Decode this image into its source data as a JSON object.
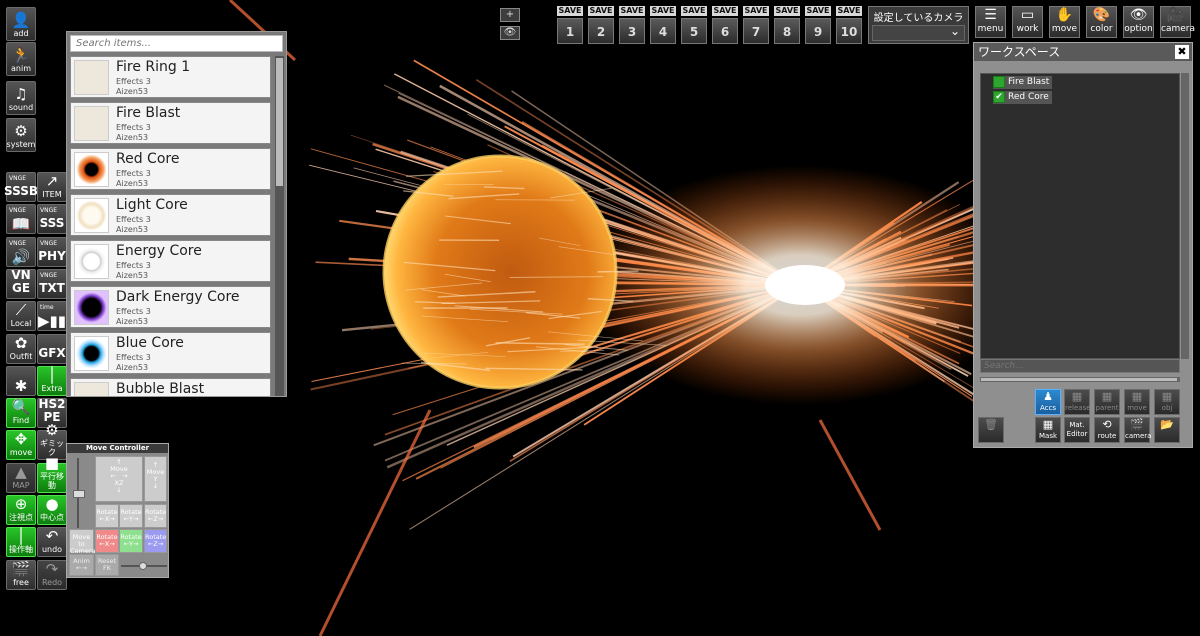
{
  "left_toolbar": [
    {
      "id": "add",
      "glyph": "👤",
      "label": "add",
      "style": "big"
    },
    {
      "id": "anim",
      "glyph": "🏃",
      "label": "anim",
      "style": "big"
    },
    {
      "id": "sound",
      "glyph": "♫",
      "label": "sound",
      "style": "big"
    },
    {
      "id": "system",
      "glyph": "⚙",
      "label": "system",
      "style": "big"
    },
    {
      "id": "vnge-ssb",
      "top": "VNGE",
      "text": "SSSB",
      "style": ""
    },
    {
      "id": "item",
      "glyph": "↗",
      "label": "ITEM",
      "style": ""
    },
    {
      "id": "vnge-book",
      "top": "VNGE",
      "glyph": "📖",
      "style": ""
    },
    {
      "id": "vnge-sss",
      "top": "VNGE",
      "text": "SSS",
      "style": ""
    },
    {
      "id": "vnge-vol",
      "top": "VNGE",
      "glyph": "🔊",
      "style": ""
    },
    {
      "id": "vnge-phy",
      "top": "VNGE",
      "text": "PHY",
      "style": ""
    },
    {
      "id": "vnge",
      "text": "VN GE",
      "style": ""
    },
    {
      "id": "vnge-txt",
      "top": "VNGE",
      "text": "TXT",
      "style": ""
    },
    {
      "id": "local",
      "glyph": "⟋",
      "label": "Local",
      "style": ""
    },
    {
      "id": "time",
      "top": "time",
      "glyph": "▶▮▮",
      "style": ""
    },
    {
      "id": "outfit",
      "glyph": "✿",
      "label": "Outfit",
      "style": ""
    },
    {
      "id": "gfx",
      "text": "GFX",
      "style": ""
    },
    {
      "id": "pose",
      "glyph": "✱",
      "style": ""
    },
    {
      "id": "extra",
      "glyph": "│",
      "label": "Extra",
      "style": "green"
    },
    {
      "id": "find",
      "glyph": "🔍",
      "label": "Find",
      "style": "green"
    },
    {
      "id": "hs2pe",
      "text": "HS2 PE",
      "style": ""
    },
    {
      "id": "move",
      "glyph": "✥",
      "label": "move",
      "style": "green"
    },
    {
      "id": "gimmick",
      "glyph": "⚙",
      "label": "ギミック",
      "style": ""
    },
    {
      "id": "map",
      "glyph": "▲",
      "label": "MAP",
      "style": "dim"
    },
    {
      "id": "parallel",
      "glyph": "■",
      "label": "平行移動",
      "style": "green"
    },
    {
      "id": "target",
      "glyph": "⊕",
      "label": "注視点",
      "style": "green"
    },
    {
      "id": "center",
      "glyph": "●",
      "label": "中心点",
      "style": "green"
    },
    {
      "id": "operate",
      "glyph": "│",
      "label": "操作軸",
      "style": "green"
    },
    {
      "id": "undo",
      "glyph": "↶",
      "label": "undo",
      "style": ""
    },
    {
      "id": "free",
      "glyph": "🎬",
      "label": "free",
      "style": ""
    },
    {
      "id": "redo",
      "glyph": "↷",
      "label": "Redo",
      "style": "dim"
    }
  ],
  "item_panel": {
    "search_placeholder": "Search items...",
    "items": [
      {
        "name": "Fire Ring 1",
        "category": "Effects 3",
        "author": "Aizen53",
        "thumb": "plain"
      },
      {
        "name": "Fire Blast",
        "category": "Effects 3",
        "author": "Aizen53",
        "thumb": "plain"
      },
      {
        "name": "Red Core",
        "category": "Effects 3",
        "author": "Aizen53",
        "thumb": "red"
      },
      {
        "name": "Light Core",
        "category": "Effects 3",
        "author": "Aizen53",
        "thumb": "light"
      },
      {
        "name": "Energy Core",
        "category": "Effects 3",
        "author": "Aizen53",
        "thumb": "ring"
      },
      {
        "name": "Dark Energy Core",
        "category": "Effects 3",
        "author": "Aizen53",
        "thumb": "dark"
      },
      {
        "name": "Blue Core",
        "category": "Effects 3",
        "author": "Aizen53",
        "thumb": "blue"
      },
      {
        "name": "Bubble Blast",
        "category": "Effects 3",
        "author": "Aizen53",
        "thumb": "plain"
      }
    ]
  },
  "move_controller": {
    "title": "Move Controller",
    "move_xz": {
      "label": "Move",
      "sub": "XZ"
    },
    "move_y": {
      "label": "Move",
      "sub": "Y"
    },
    "rotate_x_gray": "Rotate ←X→",
    "rotate_y_gray": "Rotate ←Y→",
    "rotate_z_gray": "Rotate ←Z→",
    "move_to_camera": "Move to Camera",
    "rotate_x": "Rotate ←X→",
    "rotate_y": "Rotate ←Y→",
    "rotate_z": "Rotate ←Z→",
    "anim": "Anim ←→",
    "reset_fk": "Reset FK",
    "colors": {
      "x": "#f08a8a",
      "y": "#8ee08e",
      "z": "#9a9af0"
    }
  },
  "view_buttons": {
    "zoom": "+",
    "eye": "👁"
  },
  "save_slots": {
    "label": "SAVE",
    "slots": [
      "1",
      "2",
      "3",
      "4",
      "5",
      "6",
      "7",
      "8",
      "9",
      "10"
    ]
  },
  "camera_select": {
    "label": "設定しているカメラ",
    "value": "",
    "chevron": "⌄"
  },
  "right_toolbar": [
    {
      "id": "menu",
      "glyph": "☰",
      "label": "menu"
    },
    {
      "id": "work",
      "glyph": "▭",
      "label": "work"
    },
    {
      "id": "move",
      "glyph": "✋",
      "label": "move"
    },
    {
      "id": "color",
      "glyph": "🎨",
      "label": "color"
    },
    {
      "id": "option",
      "glyph": "👁",
      "label": "option"
    },
    {
      "id": "camera",
      "glyph": "🎥",
      "label": "camera"
    }
  ],
  "workspace": {
    "title": "ワークスペース",
    "close": "✖",
    "nodes": [
      {
        "name": "Fire Blast",
        "checked": false
      },
      {
        "name": "Red Core",
        "checked": true
      }
    ],
    "search_placeholder": "Search...",
    "buttons": [
      {
        "id": "accs",
        "glyph": "♟",
        "label": "Accs",
        "style": "hl"
      },
      {
        "id": "release",
        "glyph": "▦",
        "label": "release",
        "style": "dim"
      },
      {
        "id": "parent",
        "glyph": "▦",
        "label": "parent",
        "style": "dim"
      },
      {
        "id": "move-copy",
        "glyph": "▦",
        "label": "move copy",
        "style": "dim"
      },
      {
        "id": "obj-copy",
        "glyph": "▦",
        "label": "obj copy",
        "style": "dim"
      },
      {
        "id": "delete",
        "glyph": "🗑",
        "label": "",
        "style": "dim"
      },
      {
        "id": "mask",
        "glyph": "▦",
        "label": "Mask",
        "style": ""
      },
      {
        "id": "mat-editor",
        "glyph": "",
        "label": "Mat. Editor",
        "style": ""
      },
      {
        "id": "route",
        "glyph": "⟲",
        "label": "route",
        "style": ""
      },
      {
        "id": "camera",
        "glyph": "🎬",
        "label": "camera",
        "style": ""
      },
      {
        "id": "folder",
        "glyph": "📂",
        "label": "",
        "style": ""
      }
    ]
  }
}
